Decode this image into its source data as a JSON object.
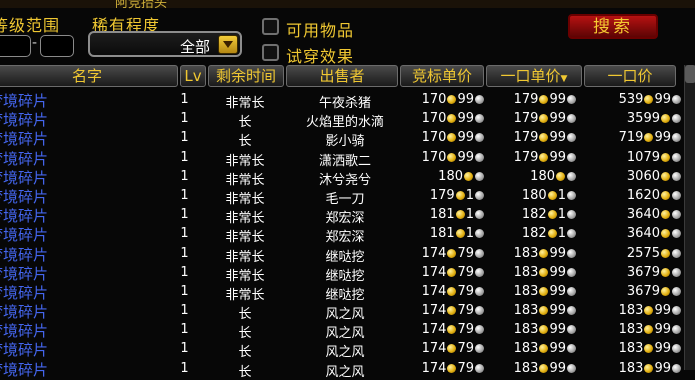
{
  "window": {
    "title_fragment": "阿竞抬头"
  },
  "filters": {
    "level_range_label": "等级范围",
    "level_min": "",
    "level_max": "",
    "level_separator": "-",
    "rarity_label": "稀有程度",
    "rarity_value": "全部",
    "usable_label": "可用物品",
    "tryon_label": "试穿效果"
  },
  "search_label": "搜索",
  "headers": {
    "name": "名字",
    "lv": "Lv",
    "time": "剩余时间",
    "seller": "出售者",
    "bid": "竞标单价",
    "buyout_unit": "一口单价",
    "buyout": "一口价"
  },
  "rows": [
    {
      "name": "梦境碎片",
      "lv": "1",
      "time": "非常长",
      "seller": "午夜杀猪",
      "bid": {
        "g": "170",
        "s": "99"
      },
      "buy": {
        "g": "179",
        "s": "99"
      },
      "total": {
        "g": "539",
        "s": "99"
      }
    },
    {
      "name": "梦境碎片",
      "lv": "1",
      "time": "长",
      "seller": "火焰里的水滴",
      "bid": {
        "g": "170",
        "s": "99"
      },
      "buy": {
        "g": "179",
        "s": "99"
      },
      "total": {
        "g": "3599",
        "s": ""
      }
    },
    {
      "name": "梦境碎片",
      "lv": "1",
      "time": "长",
      "seller": "影小骑",
      "bid": {
        "g": "170",
        "s": "99"
      },
      "buy": {
        "g": "179",
        "s": "99"
      },
      "total": {
        "g": "719",
        "s": "99"
      }
    },
    {
      "name": "梦境碎片",
      "lv": "1",
      "time": "非常长",
      "seller": "潇洒歌二",
      "bid": {
        "g": "170",
        "s": "99"
      },
      "buy": {
        "g": "179",
        "s": "99"
      },
      "total": {
        "g": "1079",
        "s": ""
      }
    },
    {
      "name": "梦境碎片",
      "lv": "1",
      "time": "非常长",
      "seller": "沐兮尧兮",
      "bid": {
        "g": "180",
        "s": ""
      },
      "buy": {
        "g": "180",
        "s": ""
      },
      "total": {
        "g": "3060",
        "s": ""
      }
    },
    {
      "name": "梦境碎片",
      "lv": "1",
      "time": "非常长",
      "seller": "毛一刀",
      "bid": {
        "g": "179",
        "s": "1"
      },
      "buy": {
        "g": "180",
        "s": "1"
      },
      "total": {
        "g": "1620",
        "s": ""
      }
    },
    {
      "name": "梦境碎片",
      "lv": "1",
      "time": "非常长",
      "seller": "郑宏深",
      "bid": {
        "g": "181",
        "s": "1"
      },
      "buy": {
        "g": "182",
        "s": "1"
      },
      "total": {
        "g": "3640",
        "s": ""
      }
    },
    {
      "name": "梦境碎片",
      "lv": "1",
      "time": "非常长",
      "seller": "郑宏深",
      "bid": {
        "g": "181",
        "s": "1"
      },
      "buy": {
        "g": "182",
        "s": "1"
      },
      "total": {
        "g": "3640",
        "s": ""
      }
    },
    {
      "name": "梦境碎片",
      "lv": "1",
      "time": "非常长",
      "seller": "继哒挖",
      "bid": {
        "g": "174",
        "s": "79"
      },
      "buy": {
        "g": "183",
        "s": "99"
      },
      "total": {
        "g": "2575",
        "s": ""
      }
    },
    {
      "name": "梦境碎片",
      "lv": "1",
      "time": "非常长",
      "seller": "继哒挖",
      "bid": {
        "g": "174",
        "s": "79"
      },
      "buy": {
        "g": "183",
        "s": "99"
      },
      "total": {
        "g": "3679",
        "s": ""
      }
    },
    {
      "name": "梦境碎片",
      "lv": "1",
      "time": "非常长",
      "seller": "继哒挖",
      "bid": {
        "g": "174",
        "s": "79"
      },
      "buy": {
        "g": "183",
        "s": "99"
      },
      "total": {
        "g": "3679",
        "s": ""
      }
    },
    {
      "name": "梦境碎片",
      "lv": "1",
      "time": "长",
      "seller": "风之风",
      "bid": {
        "g": "174",
        "s": "79"
      },
      "buy": {
        "g": "183",
        "s": "99"
      },
      "total": {
        "g": "183",
        "s": "99"
      }
    },
    {
      "name": "梦境碎片",
      "lv": "1",
      "time": "长",
      "seller": "风之风",
      "bid": {
        "g": "174",
        "s": "79"
      },
      "buy": {
        "g": "183",
        "s": "99"
      },
      "total": {
        "g": "183",
        "s": "99"
      }
    },
    {
      "name": "梦境碎片",
      "lv": "1",
      "time": "长",
      "seller": "风之风",
      "bid": {
        "g": "174",
        "s": "79"
      },
      "buy": {
        "g": "183",
        "s": "99"
      },
      "total": {
        "g": "183",
        "s": "99"
      }
    },
    {
      "name": "梦境碎片",
      "lv": "1",
      "time": "长",
      "seller": "风之风",
      "bid": {
        "g": "174",
        "s": "79"
      },
      "buy": {
        "g": "183",
        "s": "99"
      },
      "total": {
        "g": "183",
        "s": "99"
      }
    }
  ]
}
